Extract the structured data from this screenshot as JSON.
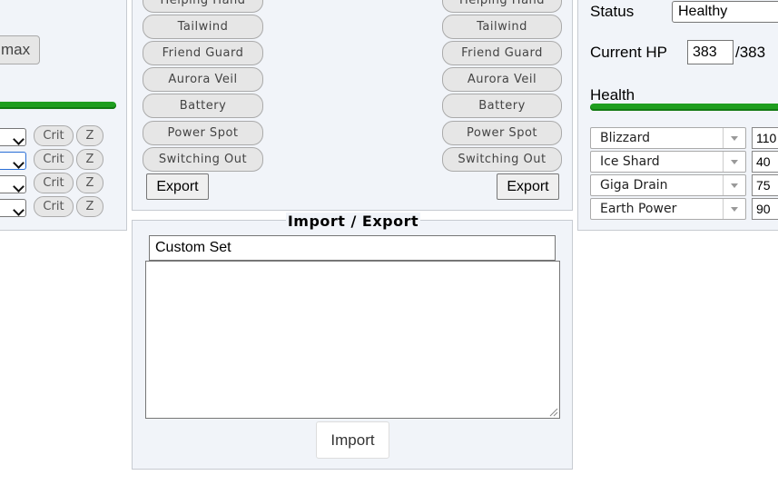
{
  "left_panel": {
    "max_button_label": "max",
    "move_rows": [
      {
        "crit": "Crit",
        "z": "Z"
      },
      {
        "crit": "Crit",
        "z": "Z"
      },
      {
        "crit": "Crit",
        "z": "Z"
      },
      {
        "crit": "Crit",
        "z": "Z"
      }
    ]
  },
  "field_panel": {
    "left_buttons": [
      "Helping Hand",
      "Tailwind",
      "Friend Guard",
      "Aurora Veil",
      "Battery",
      "Power Spot",
      "Switching Out"
    ],
    "right_buttons": [
      "Helping Hand",
      "Tailwind",
      "Friend Guard",
      "Aurora Veil",
      "Battery",
      "Power Spot",
      "Switching Out"
    ],
    "export_left": "Export",
    "export_right": "Export"
  },
  "import_export": {
    "title": "Import / Export",
    "set_name_value": "Custom Set",
    "textarea_value": "",
    "import_button": "Import"
  },
  "right_panel": {
    "status_label": "Status",
    "status_value": "Healthy",
    "current_hp_label": "Current HP",
    "current_hp_value": "383",
    "max_hp": "/383",
    "health_label": "Health",
    "health_fraction": 1.0,
    "colors": {
      "health_bar": "#1f9e1f"
    },
    "moves": [
      {
        "name": "Blizzard",
        "bp": "110"
      },
      {
        "name": "Ice Shard",
        "bp": "40"
      },
      {
        "name": "Giga Drain",
        "bp": "75"
      },
      {
        "name": "Earth Power",
        "bp": "90"
      }
    ]
  }
}
